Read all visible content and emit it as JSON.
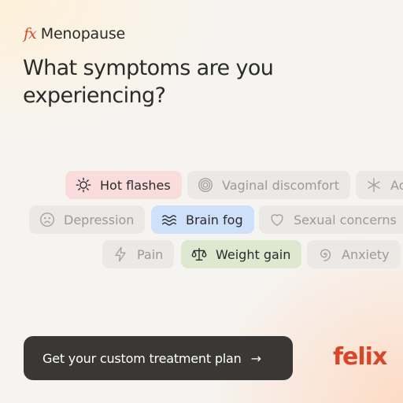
{
  "brand": {
    "glyph": "fx",
    "name": "Menopause"
  },
  "headline": "What symptoms are you experiencing?",
  "chips": {
    "hot_flashes": "Hot flashes",
    "vaginal_discomfort": "Vaginal discomfort",
    "aches": "Ac",
    "depression": "Depression",
    "brain_fog": "Brain fog",
    "sexual_concerns": "Sexual concerns",
    "pain": "Pain",
    "weight_gain": "Weight gain",
    "anxiety": "Anxiety"
  },
  "selected": [
    "Hot flashes",
    "Brain fog",
    "Weight gain"
  ],
  "colors": {
    "accent": "#d9472b",
    "pink": "#fbdcdc",
    "blue": "#cfe0fb",
    "green": "#dde8d0",
    "cta": "#3a3836"
  },
  "cta": {
    "label": "Get your custom treatment plan",
    "arrow": "→"
  },
  "logo": "felix"
}
